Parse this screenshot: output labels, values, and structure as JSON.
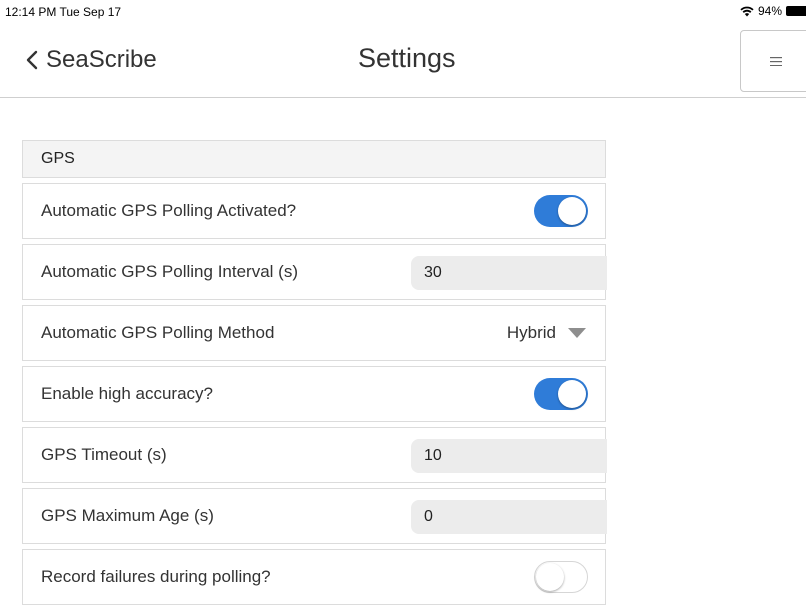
{
  "status_bar": {
    "time": "12:14 PM  Tue Sep 17",
    "battery": "94%"
  },
  "nav": {
    "back_label": "SeaScribe",
    "title": "Settings",
    "menu_icon": "menu-icon"
  },
  "gps": {
    "header": "GPS",
    "auto_polling": {
      "label": "Automatic GPS Polling Activated?",
      "on": true
    },
    "polling_interval": {
      "label": "Automatic GPS Polling Interval (s)",
      "value": "30"
    },
    "polling_method": {
      "label": "Automatic GPS Polling Method",
      "value": "Hybrid"
    },
    "high_accuracy": {
      "label": "Enable high accuracy?",
      "on": true
    },
    "timeout": {
      "label": "GPS Timeout (s)",
      "value": "10"
    },
    "max_age": {
      "label": "GPS Maximum Age (s)",
      "value": "0"
    },
    "record_failures": {
      "label": "Record failures during polling?",
      "on": false
    }
  },
  "colors": {
    "toggle_on": "#2f7cd8",
    "toggle_off": "#ffffff"
  }
}
